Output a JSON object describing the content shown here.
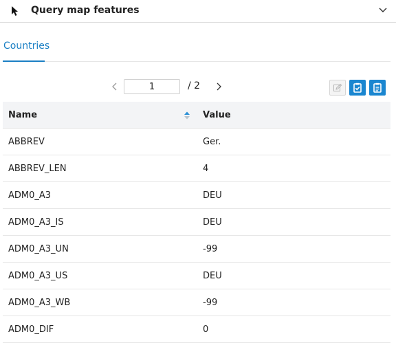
{
  "header": {
    "title": "Query map features",
    "left_icon": "cursor-arrow-icon",
    "right_icon": "chevron-down-icon"
  },
  "tabs": [
    {
      "label": "Countries",
      "active": true
    }
  ],
  "pager": {
    "current_page": "1",
    "separator": "/ 2",
    "prev_icon": "chevron-left-icon",
    "next_icon": "chevron-right-icon"
  },
  "toolbar": {
    "edit_icon": "edit-icon",
    "check_icon": "clipboard-check-icon",
    "clipboard_icon": "clipboard-icon"
  },
  "table": {
    "columns": [
      "Name",
      "Value"
    ],
    "sort_icon": "sort-icon",
    "rows": [
      {
        "name": "ABBREV",
        "value": "Ger."
      },
      {
        "name": "ABBREV_LEN",
        "value": "4"
      },
      {
        "name": "ADM0_A3",
        "value": "DEU"
      },
      {
        "name": "ADM0_A3_IS",
        "value": "DEU"
      },
      {
        "name": "ADM0_A3_UN",
        "value": "-99"
      },
      {
        "name": "ADM0_A3_US",
        "value": "DEU"
      },
      {
        "name": "ADM0_A3_WB",
        "value": "-99"
      },
      {
        "name": "ADM0_DIF",
        "value": "0"
      }
    ]
  },
  "colors": {
    "accent": "#1a7fc4",
    "button_blue": "#1a86d0",
    "header_bg": "#f3f4f6"
  }
}
